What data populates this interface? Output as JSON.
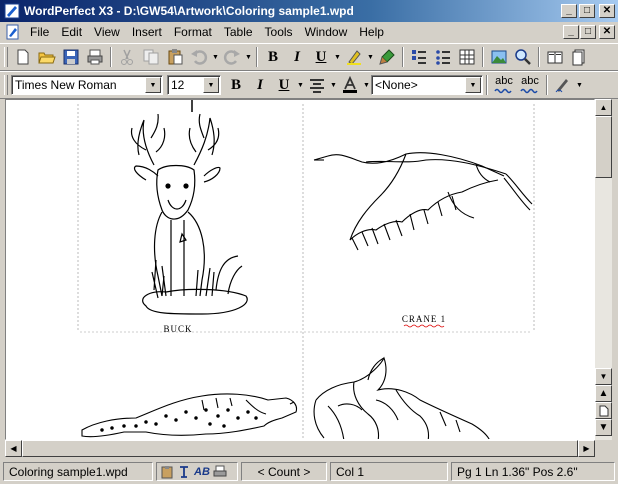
{
  "window": {
    "title": "WordPerfect X3 - D:\\GW54\\Artwork\\Coloring sample1.wpd",
    "minimize": "_",
    "maximize": "□",
    "close": "✕"
  },
  "menu": [
    "File",
    "Edit",
    "View",
    "Insert",
    "Format",
    "Table",
    "Tools",
    "Window",
    "Help"
  ],
  "property_bar": {
    "font": "Times New Roman",
    "size": "12",
    "bold": "B",
    "italic": "I",
    "underline": "U",
    "style": "<None>",
    "spell_a": "abc",
    "spell_b": "abc"
  },
  "document": {
    "captions": [
      "BUCK",
      "CRANE 1"
    ]
  },
  "status": {
    "filename": "Coloring sample1.wpd",
    "ab": "AB",
    "count": "< Count >",
    "column": "Col 1",
    "position": "Pg 1 Ln 1.36\" Pos 2.6\""
  },
  "colors": {
    "title_start": "#0a246a",
    "title_end": "#a6caf0",
    "chrome": "#d4d0c8"
  }
}
